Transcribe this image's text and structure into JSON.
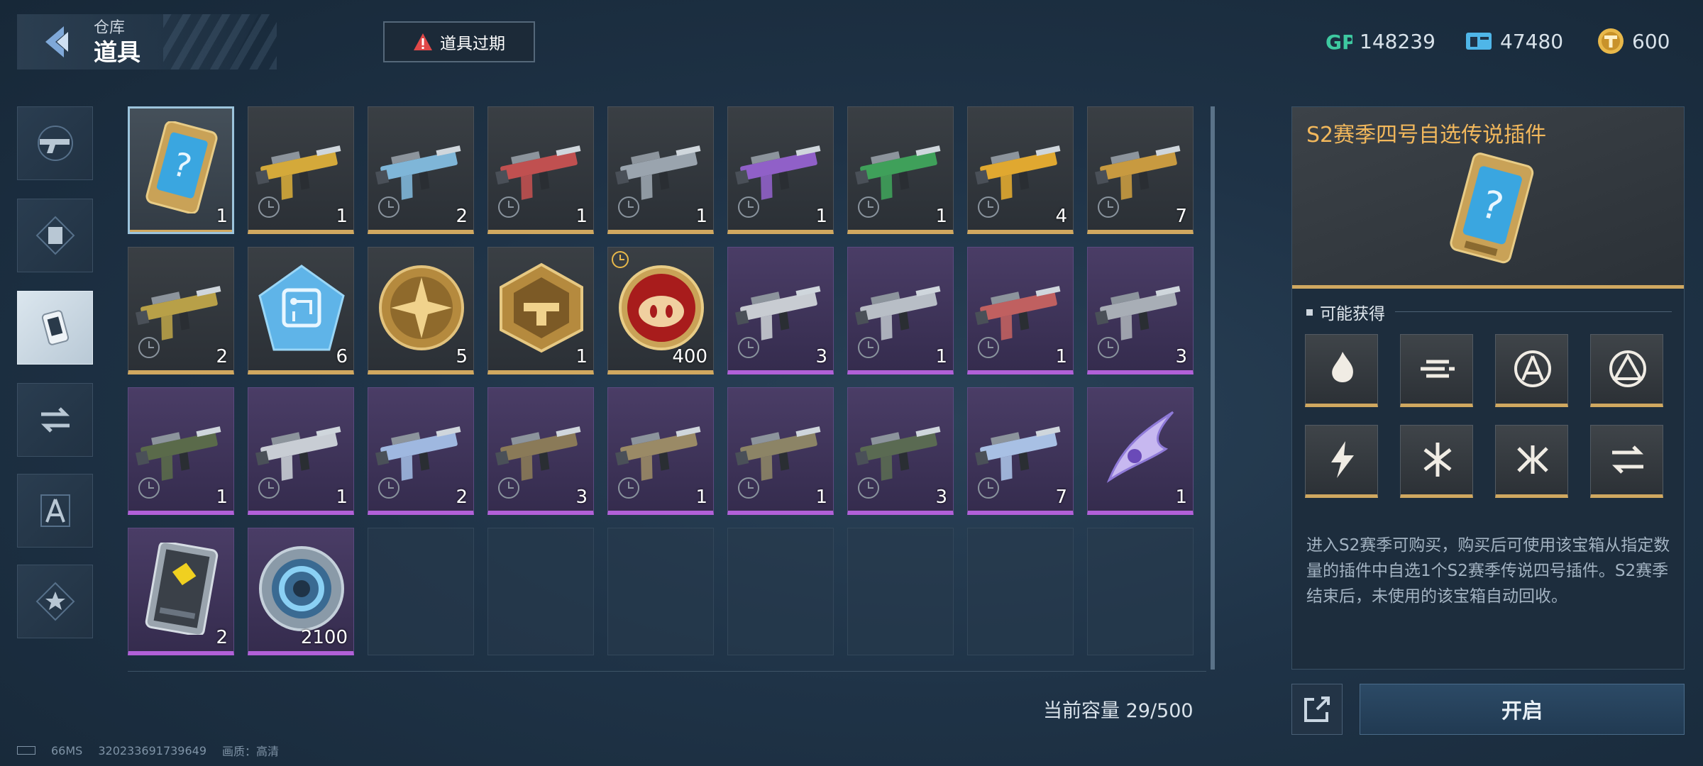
{
  "header": {
    "subtitle": "仓库",
    "title": "道具",
    "expire_label": "道具过期",
    "currencies": [
      {
        "icon": "gp-icon",
        "value": "148239",
        "color": "#3ec9a0"
      },
      {
        "icon": "ticket-icon",
        "value": "47480",
        "color": "#4fb6e8"
      },
      {
        "icon": "coin-icon",
        "value": "600",
        "color": "#e8b84a"
      }
    ]
  },
  "categories": [
    {
      "name": "gun-icon",
      "active": false
    },
    {
      "name": "frame-icon",
      "active": false
    },
    {
      "name": "item-card-icon",
      "active": true
    },
    {
      "name": "swap-icon",
      "active": false
    },
    {
      "name": "compass-icon",
      "active": false
    },
    {
      "name": "star-icon",
      "active": false
    }
  ],
  "items": [
    {
      "kind": "card",
      "rarity": "gold",
      "count": "1",
      "selected": true
    },
    {
      "kind": "gun",
      "rarity": "gold",
      "count": "1",
      "color": "#d4a93a"
    },
    {
      "kind": "gun",
      "rarity": "gold",
      "count": "2",
      "color": "#7fb6d8"
    },
    {
      "kind": "gun",
      "rarity": "gold",
      "count": "1",
      "color": "#c05050"
    },
    {
      "kind": "gun",
      "rarity": "gold",
      "count": "1",
      "color": "#9aa4ae"
    },
    {
      "kind": "gun",
      "rarity": "gold",
      "count": "1",
      "color": "#9060c8"
    },
    {
      "kind": "gun",
      "rarity": "gold",
      "count": "1",
      "color": "#3fa05a"
    },
    {
      "kind": "gun",
      "rarity": "gold",
      "count": "4",
      "color": "#e0a830"
    },
    {
      "kind": "gun",
      "rarity": "gold",
      "count": "7",
      "color": "#c89a40"
    },
    {
      "kind": "gun",
      "rarity": "gold",
      "count": "2",
      "color": "#b8a048"
    },
    {
      "kind": "chip",
      "rarity": "gold",
      "count": "6"
    },
    {
      "kind": "medal",
      "rarity": "gold",
      "count": "5"
    },
    {
      "kind": "badge",
      "rarity": "gold",
      "count": "1"
    },
    {
      "kind": "pig",
      "rarity": "gold",
      "count": "400",
      "timer": true
    },
    {
      "kind": "gun",
      "rarity": "purple",
      "count": "3",
      "color": "#c8ccd2"
    },
    {
      "kind": "gun",
      "rarity": "purple",
      "count": "1",
      "color": "#b8bec6"
    },
    {
      "kind": "gun",
      "rarity": "purple",
      "count": "1",
      "color": "#c06060"
    },
    {
      "kind": "gun",
      "rarity": "purple",
      "count": "3",
      "color": "#a8aeb6"
    },
    {
      "kind": "gun",
      "rarity": "purple",
      "count": "1",
      "color": "#5a6a4a"
    },
    {
      "kind": "gun",
      "rarity": "purple",
      "count": "1",
      "color": "#c8cdd4"
    },
    {
      "kind": "gun",
      "rarity": "purple",
      "count": "2",
      "color": "#9fb8e0"
    },
    {
      "kind": "gun",
      "rarity": "purple",
      "count": "3",
      "color": "#8a7a58"
    },
    {
      "kind": "gun",
      "rarity": "purple",
      "count": "1",
      "color": "#9a8a66"
    },
    {
      "kind": "gun",
      "rarity": "purple",
      "count": "1",
      "color": "#8c8466"
    },
    {
      "kind": "gun",
      "rarity": "purple",
      "count": "3",
      "color": "#5a6a52"
    },
    {
      "kind": "gun",
      "rarity": "purple",
      "count": "7",
      "color": "#a8c0e4"
    },
    {
      "kind": "blade",
      "rarity": "purple",
      "count": "1"
    },
    {
      "kind": "tag",
      "rarity": "purple",
      "count": "2"
    },
    {
      "kind": "disc",
      "rarity": "purple",
      "count": "2100"
    },
    {
      "kind": "empty"
    },
    {
      "kind": "empty"
    },
    {
      "kind": "empty"
    },
    {
      "kind": "empty"
    },
    {
      "kind": "empty"
    },
    {
      "kind": "empty"
    },
    {
      "kind": "empty"
    }
  ],
  "capacity_label": "当前容量 29/500",
  "detail": {
    "name": "S2赛季四号自选传说插件",
    "section_label": "可能获得",
    "rewards": [
      "flame-icon",
      "dash-icon",
      "target-a-icon",
      "triangle-icon",
      "spark-icon",
      "burst-icon",
      "claw-icon",
      "swap-arrows-icon"
    ],
    "description": "进入S2赛季可购买，购买后可使用该宝箱从指定数量的插件中自选1个S2赛季传说四号插件。S2赛季结束后，未使用的该宝箱自动回收。",
    "open_label": "开启"
  },
  "status": {
    "ping": "66MS",
    "uid": "320233691739649",
    "quality": "画质：高清"
  }
}
